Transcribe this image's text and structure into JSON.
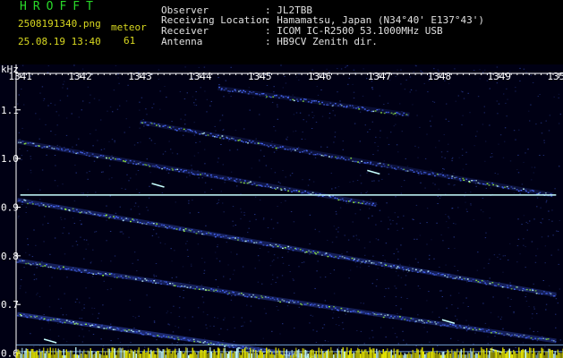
{
  "header": {
    "logo": "HROFFT",
    "filename": "2508191340.png",
    "datetime": "25.08.19 13:40",
    "kind_label": "meteor",
    "count": "61",
    "info": [
      {
        "label": "Observer",
        "value": ": JL2TBB"
      },
      {
        "label": "Receiving Location",
        "value": ": Hamamatsu, Japan (N34°40' E137°43')"
      },
      {
        "label": "Receiver",
        "value": ": ICOM IC-R2500 53.1000MHz USB"
      },
      {
        "label": "Antenna",
        "value": ": HB9CV Zenith dir."
      }
    ]
  },
  "colors": {
    "background": "#000014",
    "signal": "#4a6cff",
    "bright": "#c8ffff",
    "strong": "#9fff3a",
    "axis": "#ffffff",
    "hline": "#8fc8ff"
  },
  "chart_data": {
    "type": "heatmap",
    "ylabel": "kHz",
    "x_unit": "time (HHMM)",
    "x_ticks": [
      "1341",
      "1342",
      "1343",
      "1344",
      "1345",
      "1346",
      "1347",
      "1348",
      "1349",
      "1350"
    ],
    "y_ticks": [
      "1.1",
      "1.0",
      "0.9",
      "0.8",
      "0.7",
      "0.6"
    ],
    "xlim": [
      1340.93,
      1350.02
    ],
    "ylim": [
      0.59,
      1.175
    ],
    "carrier_line": {
      "y": 0.925,
      "x": [
        1341.0,
        1349.95
      ]
    },
    "reference_lines": [
      0.617,
      0.603
    ],
    "traces": [
      {
        "x": [
          1340.95,
          1346.95
        ],
        "y": [
          1.035,
          0.905
        ],
        "strength": 0.45
      },
      {
        "x": [
          1340.95,
          1349.95
        ],
        "y": [
          0.915,
          0.72
        ],
        "strength": 0.65
      },
      {
        "x": [
          1340.95,
          1349.95
        ],
        "y": [
          0.79,
          0.625
        ],
        "strength": 0.65
      },
      {
        "x": [
          1340.95,
          1345.95
        ],
        "y": [
          0.68,
          0.59
        ],
        "strength": 0.85
      },
      {
        "x": [
          1343.0,
          1349.9
        ],
        "y": [
          1.075,
          0.925
        ],
        "strength": 0.35
      },
      {
        "x": [
          1344.3,
          1347.5
        ],
        "y": [
          1.145,
          1.09
        ],
        "strength": 0.3
      }
    ],
    "meteor_marks": [
      {
        "x": 1346.9,
        "y": 0.972
      },
      {
        "x": 1348.15,
        "y": 0.665
      },
      {
        "x": 1343.3,
        "y": 0.945
      },
      {
        "x": 1341.5,
        "y": 0.625
      },
      {
        "x": 1348.95,
        "y": 0.605
      }
    ]
  }
}
